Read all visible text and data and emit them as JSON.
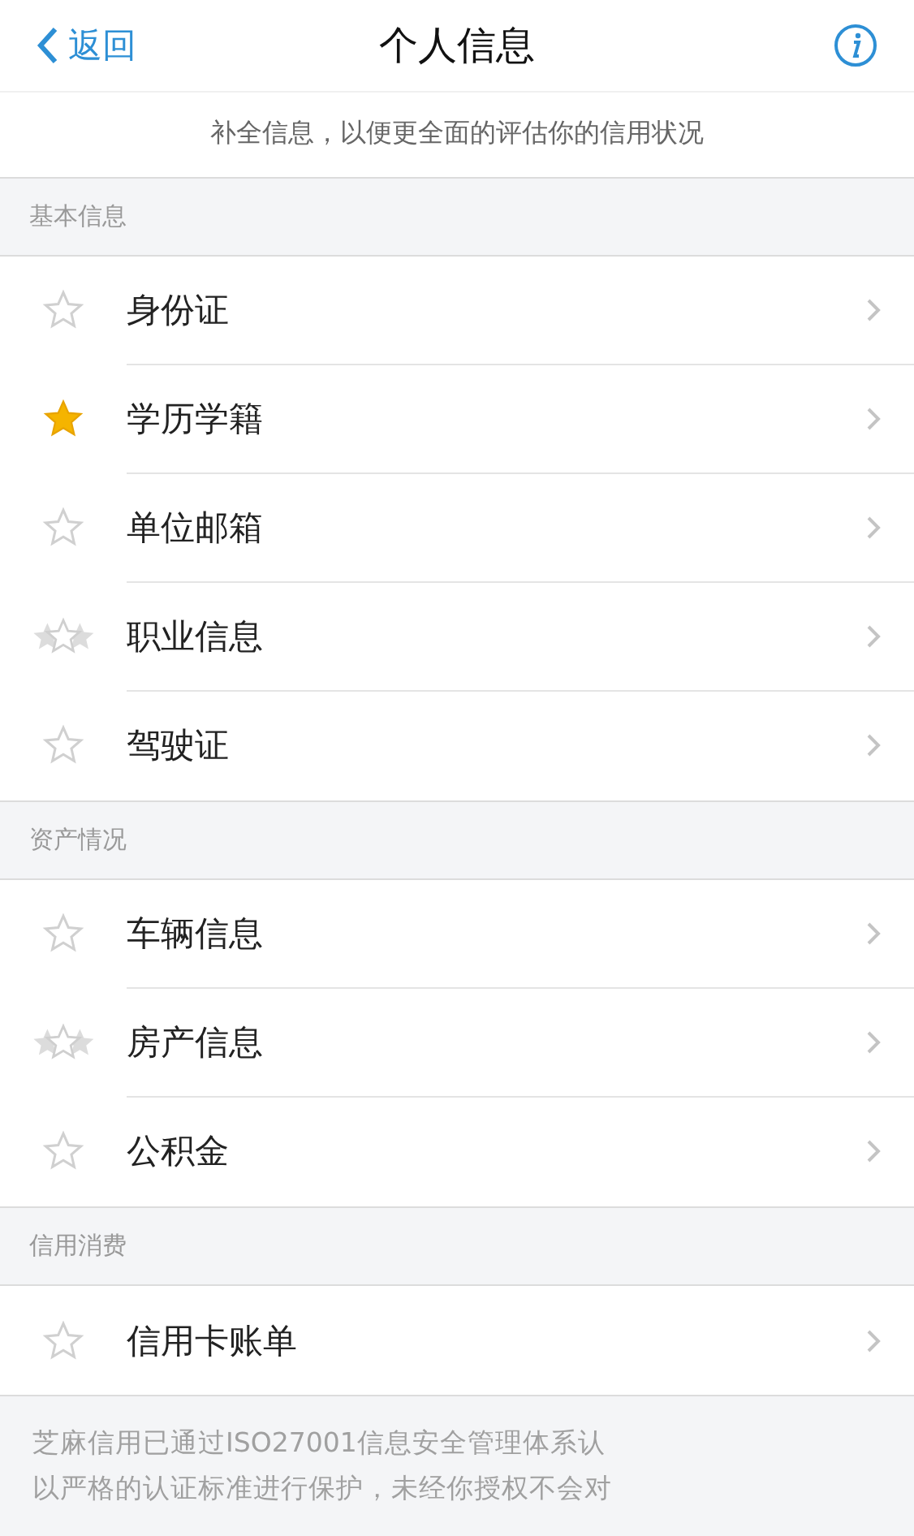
{
  "nav": {
    "back": "返回",
    "title": "个人信息"
  },
  "subtitle": "补全信息，以便更全面的评估你的信用状况",
  "sections": [
    {
      "title": "基本信息",
      "items": [
        {
          "label": "身份证",
          "kind": "outline"
        },
        {
          "label": "学历学籍",
          "kind": "filled"
        },
        {
          "label": "单位邮箱",
          "kind": "outline"
        },
        {
          "label": "职业信息",
          "kind": "multi"
        },
        {
          "label": "驾驶证",
          "kind": "outline"
        }
      ]
    },
    {
      "title": "资产情况",
      "items": [
        {
          "label": "车辆信息",
          "kind": "outline"
        },
        {
          "label": "房产信息",
          "kind": "multi"
        },
        {
          "label": "公积金",
          "kind": "outline"
        }
      ]
    },
    {
      "title": "信用消费",
      "items": [
        {
          "label": "信用卡账单",
          "kind": "outline"
        }
      ]
    }
  ],
  "footer": [
    "芝麻信用已通过ISO27001信息安全管理体系认",
    "以严格的认证标准进行保护，未经你授权不会对"
  ]
}
